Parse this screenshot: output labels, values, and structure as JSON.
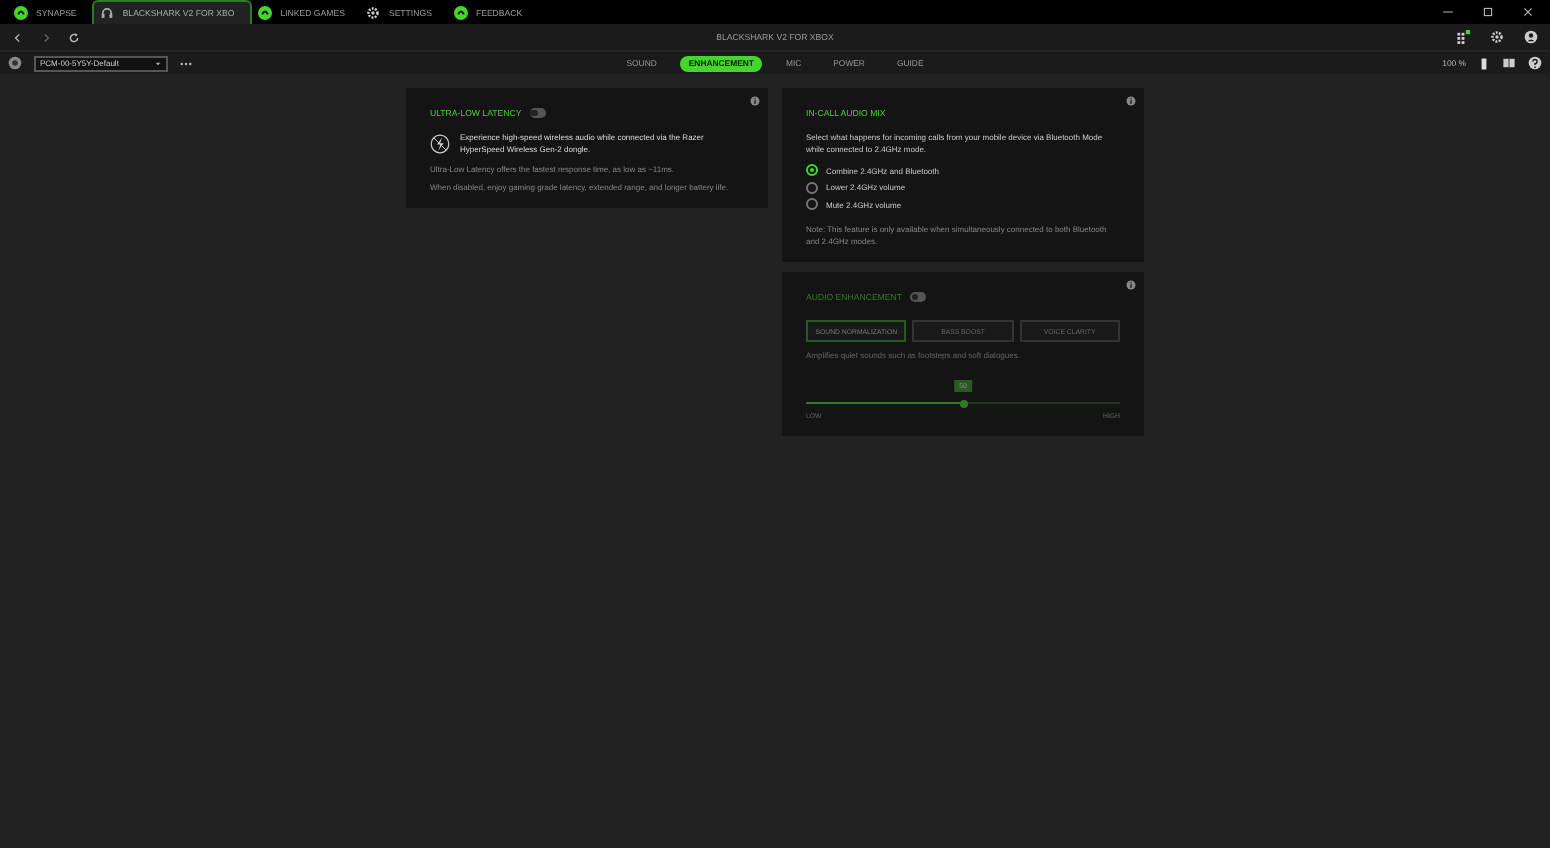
{
  "title_bar": {
    "tabs": [
      {
        "label": "SYNAPSE",
        "kind": "app",
        "selected": false
      },
      {
        "label": "BLACKSHARK V2 FOR XBO",
        "kind": "device",
        "selected": true
      },
      {
        "label": "LINKED GAMES",
        "kind": "app",
        "selected": false
      },
      {
        "label": "SETTINGS",
        "kind": "settings",
        "selected": false
      },
      {
        "label": "FEEDBACK",
        "kind": "app",
        "selected": false
      }
    ]
  },
  "nav_bar": {
    "device_title": "BLACKSHARK V2 FOR XBOX"
  },
  "sub_bar": {
    "profile": "PCM-00-5Y5Y-Default",
    "sections": [
      {
        "label": "SOUND",
        "selected": false
      },
      {
        "label": "ENHANCEMENT",
        "selected": true
      },
      {
        "label": "MIC",
        "selected": false
      },
      {
        "label": "POWER",
        "selected": false
      },
      {
        "label": "GUIDE",
        "selected": false
      }
    ],
    "battery": "100 %"
  },
  "ultra_low_latency": {
    "title": "ULTRA-LOW LATENCY",
    "on": false,
    "info": "Experience high-speed wireless audio while connected via the Razer HyperSpeed Wireless Gen-2 dongle.",
    "lines": [
      "Ultra-Low Latency offers the fastest response time, as low as ~11ms.",
      "When disabled, enjoy gaming grade latency, extended range, and longer battery life."
    ]
  },
  "in_call_audio_mix": {
    "title": "IN-CALL AUDIO MIX",
    "description": "Select what happens for incoming calls from your mobile device via Bluetooth Mode while connected to 2.4GHz mode.",
    "options": [
      {
        "label": "Combine 2.4GHz and Bluetooth",
        "selected": true
      },
      {
        "label": "Lower 2.4GHz volume",
        "selected": false
      },
      {
        "label": "Mute 2.4GHz volume",
        "selected": false
      }
    ],
    "note": "Note: This feature is only available when simultaneously connected to both Bluetooth and 2.4GHz modes."
  },
  "audio_enhancement": {
    "title": "AUDIO ENHANCEMENT",
    "on": false,
    "modes": [
      {
        "label": "SOUND NORMALIZATION",
        "selected": true
      },
      {
        "label": "BASS BOOST",
        "selected": false
      },
      {
        "label": "VOICE CLARITY",
        "selected": false
      }
    ],
    "description": "Amplifies quiet sounds such as footsteps and soft dialogues.",
    "slider": {
      "level": 0.5,
      "value_label": "50",
      "min_label": "LOW",
      "max_label": "HIGH"
    }
  }
}
